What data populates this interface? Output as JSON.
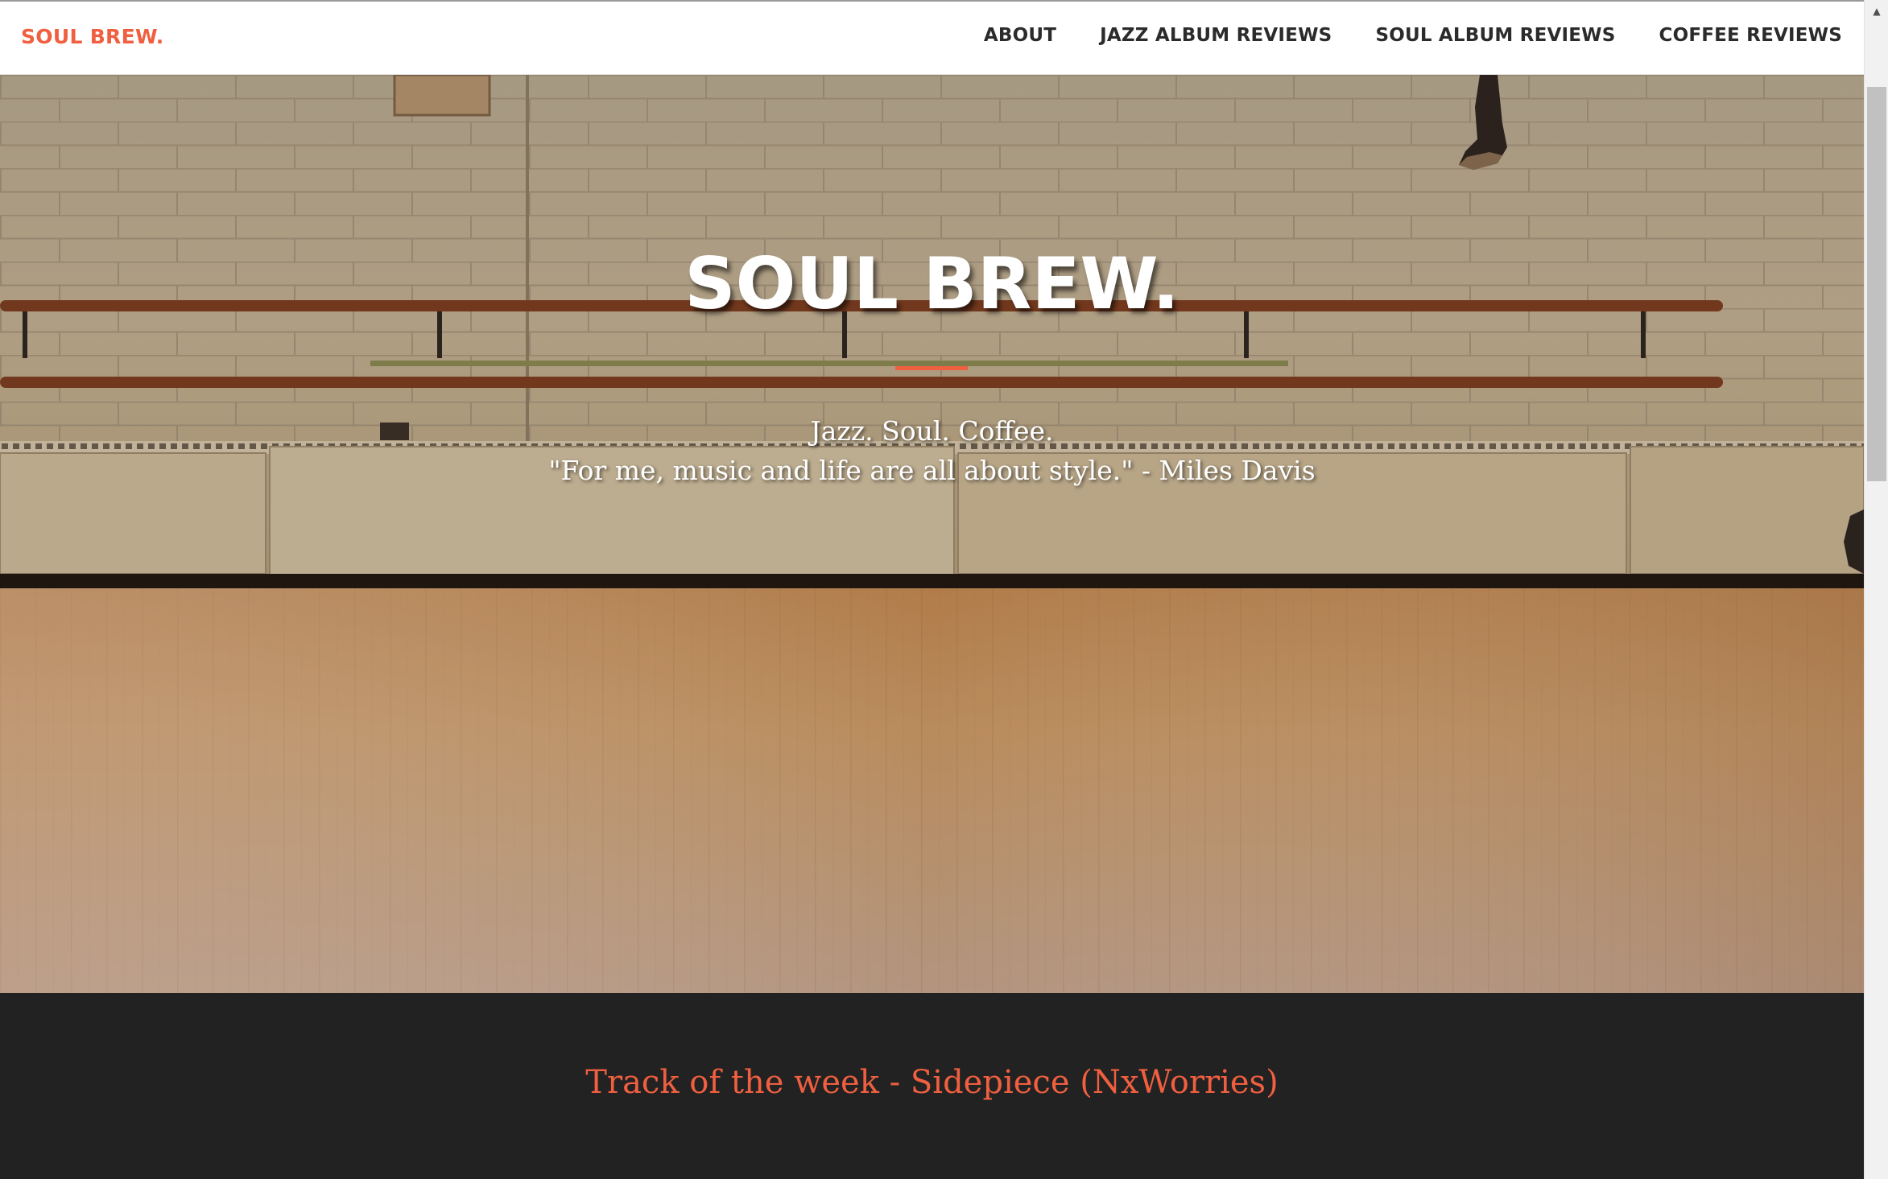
{
  "nav": {
    "brand": "SOUL BREW.",
    "links": [
      {
        "label": "ABOUT"
      },
      {
        "label": "JAZZ ALBUM REVIEWS"
      },
      {
        "label": "SOUL ALBUM REVIEWS"
      },
      {
        "label": "COFFEE REVIEWS"
      }
    ]
  },
  "hero": {
    "title": "SOUL BREW.",
    "tagline_line1": "Jazz. Soul. Coffee.",
    "tagline_line2": "\"For me, music and life are all about style.\" - Miles Davis"
  },
  "track_section": {
    "heading": "Track of the week - Sidepiece (NxWorries)"
  },
  "scrollbar": {
    "up_icon": "scroll-up-arrow-icon"
  },
  "colors": {
    "accent": "#f05f40",
    "dark_section": "#222222",
    "nav_text": "#2b2b2b"
  }
}
